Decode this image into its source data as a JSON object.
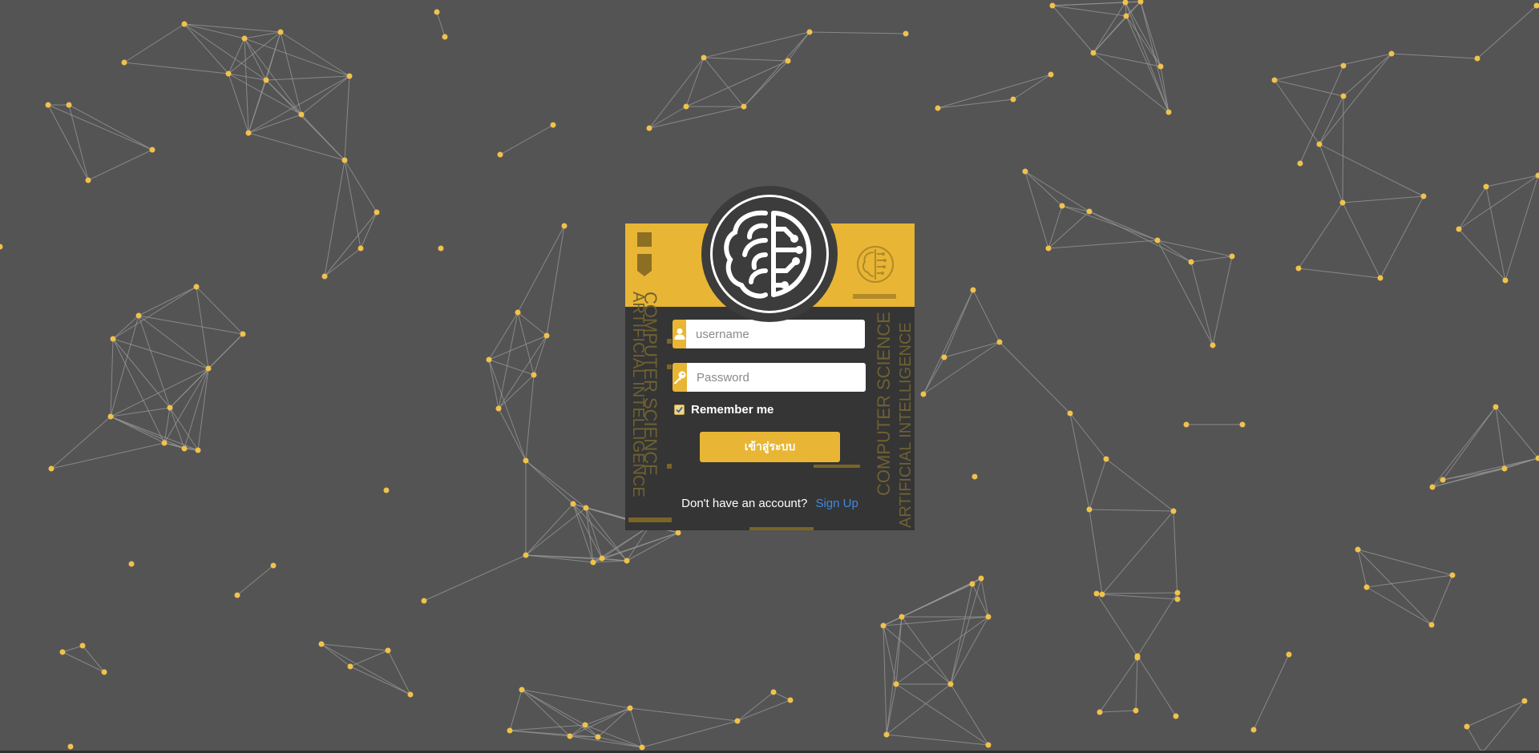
{
  "login": {
    "username_placeholder": "username",
    "password_placeholder": "Password",
    "remember_label": "Remember me",
    "remember_checked": true,
    "submit_label": "เข้าสู่ระบบ",
    "signup_prompt": "Don't have an account?",
    "signup_link": "Sign Up"
  },
  "decor": {
    "side_left_a": "COMPUTER SCIENCE",
    "side_left_b": "ARTIFICIAL INTELLIGENCE",
    "side_right_a": "COMPUTER SCIENCE",
    "side_right_b": "ARTIFICIAL INTELLIGENCE"
  },
  "colors": {
    "background": "#545454",
    "accent": "#e8b634",
    "card": "#353535",
    "link": "#3a8be6",
    "node": "#f0c24b"
  },
  "icons": {
    "logo": "brain-circuit-icon",
    "username": "user-icon",
    "password": "key-icon",
    "remember": "check-icon"
  }
}
